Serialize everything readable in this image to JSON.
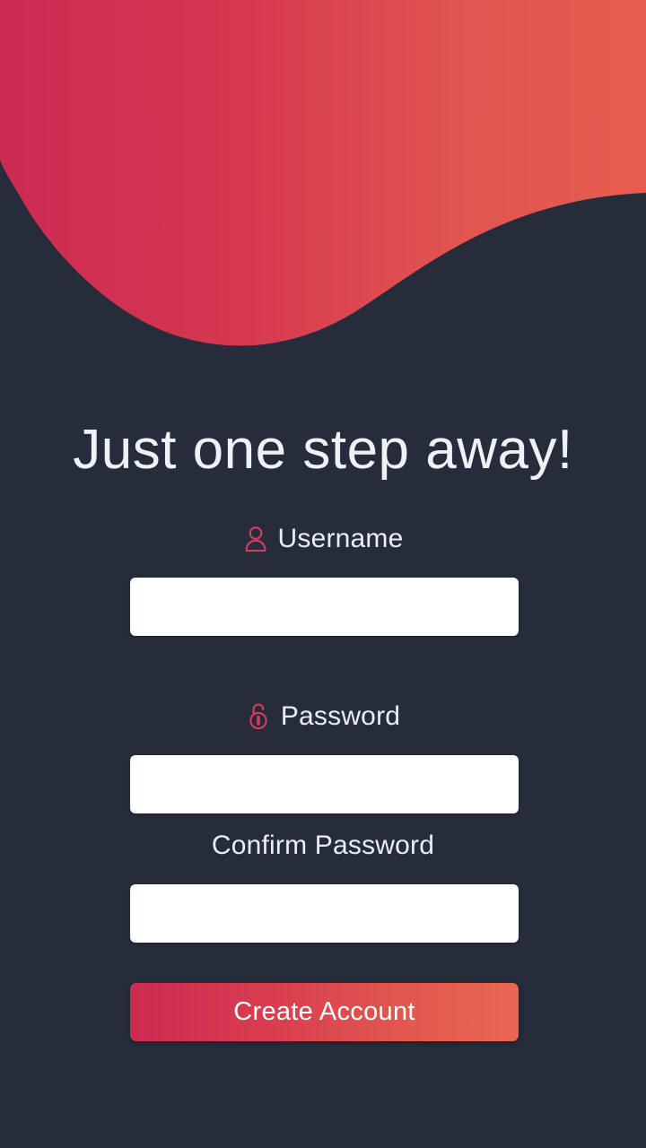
{
  "screen": {
    "name": "create-account",
    "background_color": "#262c3a"
  },
  "decoration": {
    "wave": {
      "icon": "wave-blob-shape",
      "gradient_start": "#cd2a54",
      "gradient_end": "#e75d4e"
    }
  },
  "header": {
    "title": "Just one step away!"
  },
  "form": {
    "fields": [
      {
        "key": "username",
        "label": "Username",
        "icon": "user-icon",
        "icon_color": "#d93b63",
        "value": "",
        "placeholder": ""
      },
      {
        "key": "password",
        "label": "Password",
        "icon": "unlocked-padlock-icon",
        "icon_color": "#d93b63",
        "value": "",
        "placeholder": ""
      },
      {
        "key": "confirm_password",
        "label": "Confirm Password",
        "icon": "",
        "icon_color": "",
        "value": "",
        "placeholder": ""
      }
    ],
    "submit": {
      "label": "Create Account",
      "gradient_start": "#cd2a50",
      "gradient_end": "#e86751",
      "text_color": "#ffffff"
    }
  }
}
